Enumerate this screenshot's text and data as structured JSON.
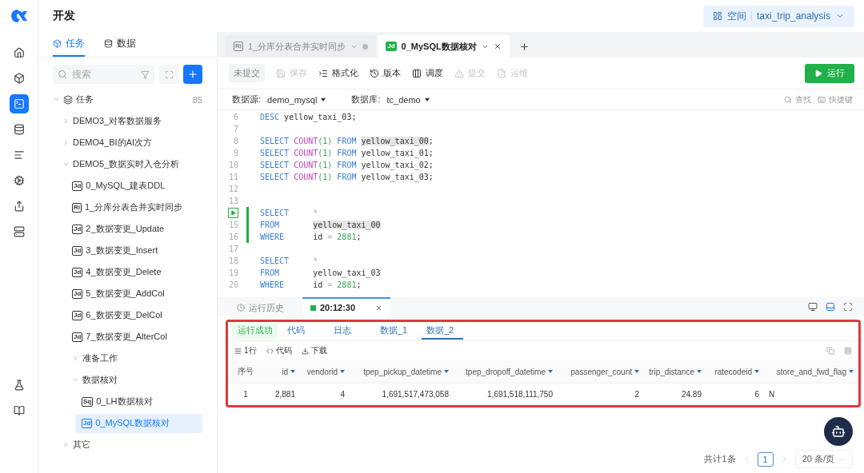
{
  "rail": [
    {
      "kind": "home",
      "selected": false
    },
    {
      "kind": "cube",
      "selected": false
    },
    {
      "kind": "terminal",
      "selected": true
    },
    {
      "kind": "database",
      "selected": false
    },
    {
      "kind": "bars",
      "selected": false
    },
    {
      "kind": "gear",
      "selected": false
    },
    {
      "kind": "share",
      "selected": false
    },
    {
      "kind": "server",
      "selected": false
    }
  ],
  "rail_bottom": [
    {
      "kind": "flask"
    },
    {
      "kind": "book"
    }
  ],
  "header": {
    "title": "开发",
    "space_label": "空间",
    "space_value": "taxi_trip_analysis"
  },
  "sidebar": {
    "tabs": [
      {
        "label": "任务",
        "selected": true
      },
      {
        "label": "数据",
        "selected": false
      }
    ],
    "search": {
      "placeholder": "搜索"
    },
    "tree": [
      {
        "label": "任务",
        "count": "85",
        "expanded": true,
        "children": [
          {
            "label": "DEMO3_对客数据服务",
            "expanded": false
          },
          {
            "label": "DEMO4_BI的AI次方",
            "expanded": false
          },
          {
            "label": "DEMO5_数据实时入仓分析",
            "expanded": true,
            "children": [
              {
                "label": "0_MySQL_建表DDL",
                "badge": "Jd",
                "selected": false
              },
              {
                "label": "1_分库分表合并实时同步",
                "badge": "Ri",
                "selected": false
              },
              {
                "label": "2_数据变更_Update",
                "badge": "Jd",
                "selected": false
              },
              {
                "label": "3_数据变更_Insert",
                "badge": "Jd",
                "selected": false
              },
              {
                "label": "4_数据变更_Delete",
                "badge": "Jd",
                "selected": false
              },
              {
                "label": "5_数据变更_AddCol",
                "badge": "Jd",
                "selected": false
              },
              {
                "label": "6_数据变更_DelCol",
                "badge": "Jd",
                "selected": false
              },
              {
                "label": "7_数据变更_AlterCol",
                "badge": "Jd",
                "selected": false
              },
              {
                "label": "准备工作",
                "expanded": false
              },
              {
                "label": "数据核对",
                "expanded": true,
                "children": [
                  {
                    "label": "0_LH数据核对",
                    "badge": "Sq",
                    "selected": false
                  },
                  {
                    "label": "0_MySQL数据核对",
                    "badge": "Jd",
                    "selected": true
                  }
                ]
              }
            ]
          },
          {
            "label": "其它",
            "expanded": false
          }
        ]
      }
    ]
  },
  "file_tabs": [
    {
      "badge": "Ri",
      "label": "1_分库分表合并实时同步",
      "selected": false
    },
    {
      "badge": "Jd",
      "label": "0_MySQL数据核对",
      "selected": true
    }
  ],
  "toolbar": {
    "status": "未提交",
    "actions": [
      {
        "label": "保存",
        "disabled": true
      },
      {
        "label": "格式化",
        "disabled": false
      },
      {
        "label": "版本",
        "disabled": false
      },
      {
        "label": "调度",
        "disabled": false
      },
      {
        "label": "提交",
        "disabled": true
      },
      {
        "label": "运维",
        "disabled": true
      }
    ],
    "run": "运行"
  },
  "datasource": {
    "source_label": "数据源:",
    "source": "demo_mysql",
    "db_label": "数据库:",
    "db": "tc_demo",
    "find": "查找",
    "shortcuts": "快捷键"
  },
  "code": [
    {
      "n": "6",
      "tokens": [
        {
          "t": "DESC ",
          "kind": "keyword"
        },
        {
          "t": "yellow_taxi_03;",
          "kind": "plain"
        }
      ]
    },
    {
      "n": "7"
    },
    {
      "n": "8",
      "tokens": [
        {
          "t": "SELECT ",
          "kind": "keyword"
        },
        {
          "t": "COUNT",
          "kind": "function"
        },
        {
          "t": "(1) ",
          "kind": "number"
        },
        {
          "t": "FROM ",
          "kind": "keyword"
        },
        {
          "t": "yellow_taxi_00",
          "kind": "highlight"
        },
        {
          "t": ";",
          "kind": "plain"
        }
      ]
    },
    {
      "n": "9",
      "tokens": [
        {
          "t": "SELECT ",
          "kind": "keyword"
        },
        {
          "t": "COUNT",
          "kind": "function"
        },
        {
          "t": "(1) ",
          "kind": "number"
        },
        {
          "t": "FROM ",
          "kind": "keyword"
        },
        {
          "t": "yellow_taxi_01;",
          "kind": "plain"
        }
      ]
    },
    {
      "n": "10",
      "tokens": [
        {
          "t": "SELECT ",
          "kind": "keyword"
        },
        {
          "t": "COUNT",
          "kind": "function"
        },
        {
          "t": "(1) ",
          "kind": "number"
        },
        {
          "t": "FROM ",
          "kind": "keyword"
        },
        {
          "t": "yellow_taxi_02;",
          "kind": "plain"
        }
      ]
    },
    {
      "n": "11",
      "tokens": [
        {
          "t": "SELECT ",
          "kind": "keyword"
        },
        {
          "t": "COUNT",
          "kind": "function"
        },
        {
          "t": "(1) ",
          "kind": "number"
        },
        {
          "t": "FROM ",
          "kind": "keyword"
        },
        {
          "t": "yellow_taxi_03;",
          "kind": "plain"
        }
      ]
    },
    {
      "n": "12"
    },
    {
      "n": "13"
    },
    {
      "run": true,
      "active": true,
      "tokens": [
        {
          "t": "SELECT     ",
          "kind": "keyword"
        },
        {
          "t": "*",
          "kind": "operator"
        }
      ]
    },
    {
      "n": "15",
      "active": true,
      "tokens": [
        {
          "t": "FROM       ",
          "kind": "keyword"
        },
        {
          "t": "yellow_taxi_00",
          "kind": "highlight"
        }
      ]
    },
    {
      "n": "16",
      "active": true,
      "tokens": [
        {
          "t": "WHERE      ",
          "kind": "keyword"
        },
        {
          "t": "id ",
          "kind": "plain"
        },
        {
          "t": "= ",
          "kind": "operator"
        },
        {
          "t": "2881",
          "kind": "number"
        },
        {
          "t": ";",
          "kind": "plain"
        }
      ]
    },
    {
      "n": "17"
    },
    {
      "n": "18",
      "tokens": [
        {
          "t": "SELECT     ",
          "kind": "keyword"
        },
        {
          "t": "*",
          "kind": "operator"
        }
      ]
    },
    {
      "n": "19",
      "tokens": [
        {
          "t": "FROM       ",
          "kind": "keyword"
        },
        {
          "t": "yellow_taxi_03",
          "kind": "plain"
        }
      ]
    },
    {
      "n": "20",
      "tokens": [
        {
          "t": "WHERE      ",
          "kind": "keyword"
        },
        {
          "t": "id ",
          "kind": "plain"
        },
        {
          "t": "= ",
          "kind": "operator"
        },
        {
          "t": "2881",
          "kind": "number"
        },
        {
          "t": ";",
          "kind": "plain"
        }
      ]
    }
  ],
  "result_tabs": [
    {
      "label": "运行历史",
      "kind": "history",
      "selected": false
    },
    {
      "label": "20:12:30",
      "kind": "run",
      "selected": true
    }
  ],
  "result": {
    "tabs": [
      {
        "label": "运行成功",
        "kind": "status",
        "selected": false
      },
      {
        "label": "代码",
        "kind": "tab",
        "selected": false
      },
      {
        "label": "日志",
        "kind": "tab",
        "selected": false
      },
      {
        "label": "数据_1",
        "kind": "tab",
        "selected": false
      },
      {
        "label": "数据_2",
        "kind": "tab",
        "selected": true
      }
    ],
    "tools": [
      "1行",
      "代码",
      "下载"
    ],
    "columns": [
      "序号",
      "id",
      "vendorid",
      "tpep_pickup_datetime",
      "tpep_dropoff_datetime",
      "passenger_count",
      "trip_distance",
      "ratecodeid",
      "store_and_fwd_flag"
    ],
    "rows": [
      [
        "1",
        "2,881",
        "4",
        "1,691,517,473,058",
        "1,691,518,111,750",
        "2",
        "24.89",
        "6",
        "N"
      ]
    ]
  },
  "pagination": {
    "total": "共计1条",
    "page": "1",
    "size": "20 条/页"
  }
}
